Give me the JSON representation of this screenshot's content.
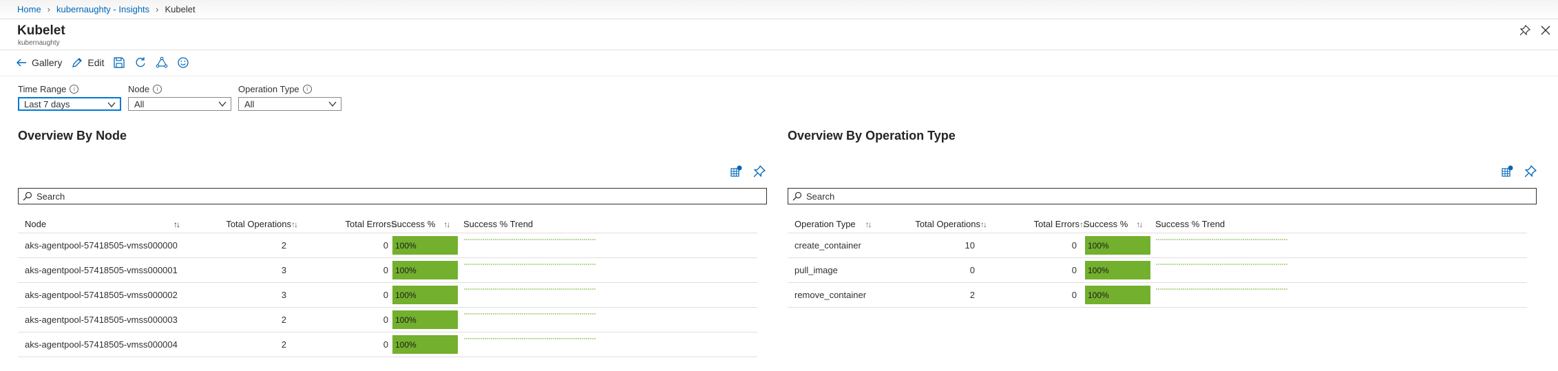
{
  "breadcrumb": {
    "home": "Home",
    "insights": "kubernaughty - Insights",
    "current": "Kubelet"
  },
  "header": {
    "title": "Kubelet",
    "subtitle": "kubernaughty"
  },
  "toolbar": {
    "gallery_label": "Gallery",
    "edit_label": "Edit"
  },
  "params": {
    "time_range": {
      "label": "Time Range",
      "value": "Last 7 days"
    },
    "node": {
      "label": "Node",
      "value": "All"
    },
    "operation_type": {
      "label": "Operation Type",
      "value": "All"
    }
  },
  "node_section": {
    "title": "Overview By Node",
    "search_placeholder": "Search",
    "columns": [
      "Node",
      "Total Operations",
      "Total Errors",
      "Success %",
      "Success % Trend"
    ],
    "rows": [
      {
        "name": "aks-agentpool-57418505-vmss000000",
        "total_ops": "2",
        "total_errors": "0",
        "success": "100%"
      },
      {
        "name": "aks-agentpool-57418505-vmss000001",
        "total_ops": "3",
        "total_errors": "0",
        "success": "100%"
      },
      {
        "name": "aks-agentpool-57418505-vmss000002",
        "total_ops": "3",
        "total_errors": "0",
        "success": "100%"
      },
      {
        "name": "aks-agentpool-57418505-vmss000003",
        "total_ops": "2",
        "total_errors": "0",
        "success": "100%"
      },
      {
        "name": "aks-agentpool-57418505-vmss000004",
        "total_ops": "2",
        "total_errors": "0",
        "success": "100%"
      }
    ]
  },
  "op_section": {
    "title": "Overview By Operation Type",
    "search_placeholder": "Search",
    "columns": [
      "Operation Type",
      "Total Operations",
      "Total Errors",
      "Success %",
      "Success % Trend"
    ],
    "rows": [
      {
        "name": "create_container",
        "total_ops": "10",
        "total_errors": "0",
        "success": "100%"
      },
      {
        "name": "pull_image",
        "total_ops": "0",
        "total_errors": "0",
        "success": "100%"
      },
      {
        "name": "remove_container",
        "total_ops": "2",
        "total_errors": "0",
        "success": "100%"
      }
    ]
  },
  "colors": {
    "link": "#0067b8",
    "success_bar": "#72b02d",
    "trend_line": "#72b02d",
    "focus": "#0078d4"
  }
}
